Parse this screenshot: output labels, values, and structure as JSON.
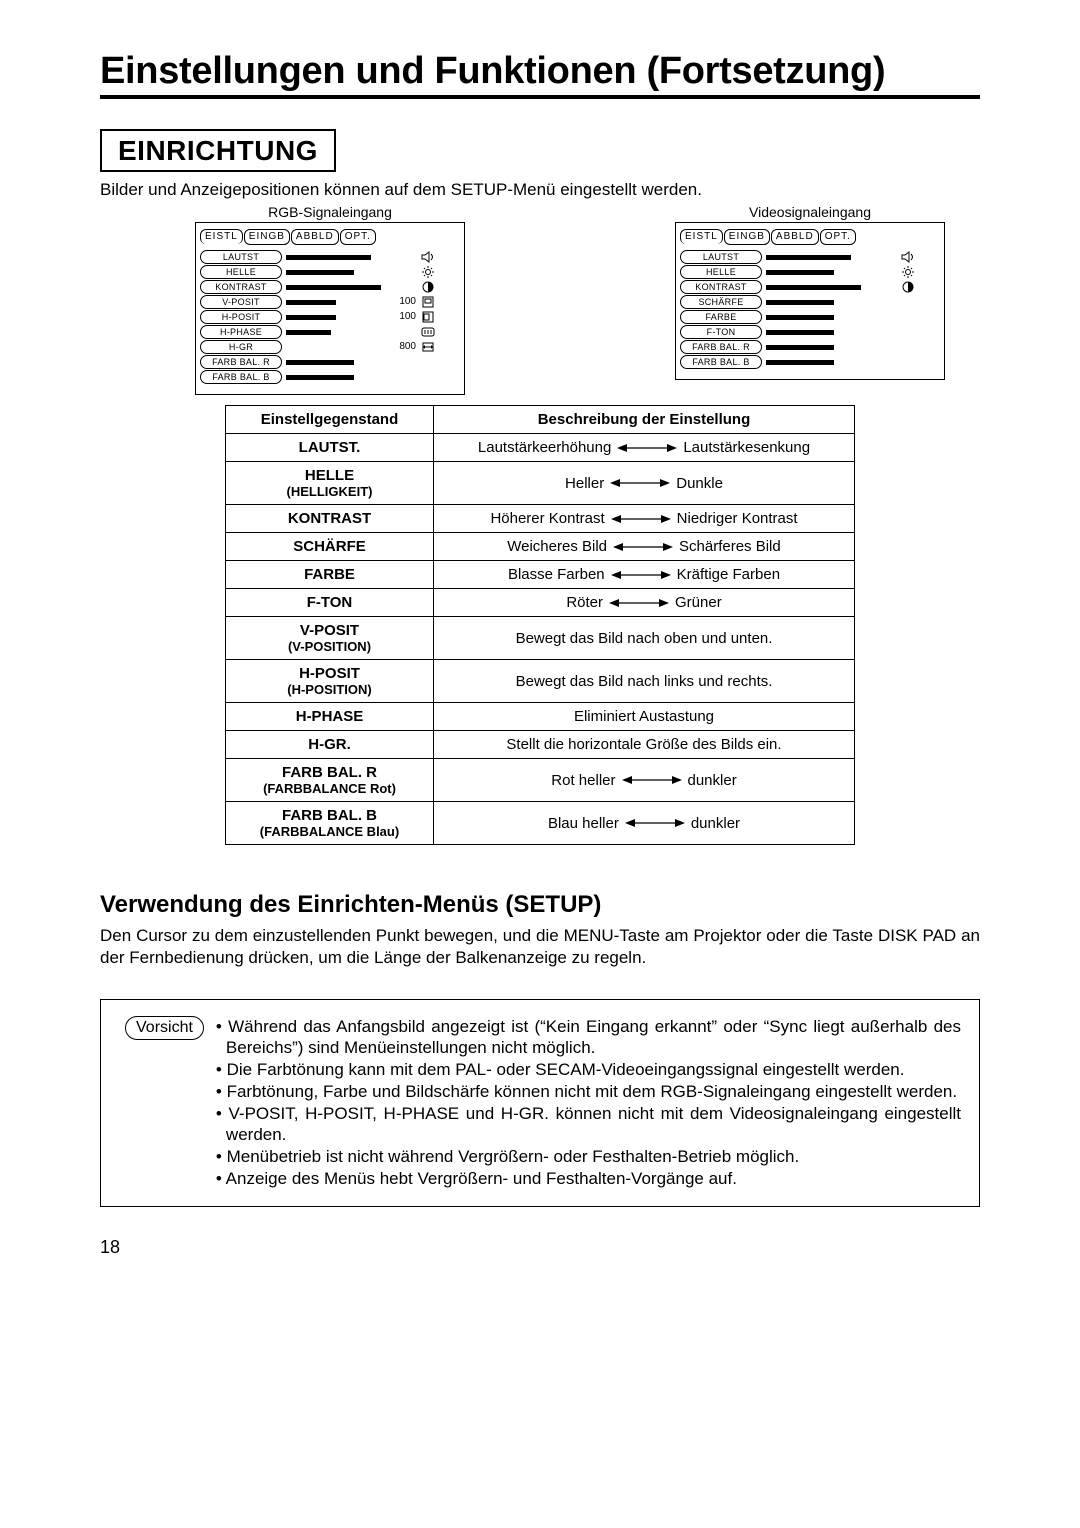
{
  "title": "Einstellungen und Funktionen (Fortsetzung)",
  "section": "EINRICHTUNG",
  "intro": "Bilder und Anzeigepositionen können auf dem SETUP-Menü eingestellt werden.",
  "page_number": "18",
  "menus": {
    "rgb": {
      "caption": "RGB-Signaleingang",
      "tabs": [
        "EISTL",
        "EINGB",
        "ABBLD",
        "OPT."
      ],
      "rows": [
        {
          "label": "LAUTST",
          "bar": 85,
          "value": "",
          "icon": "speaker"
        },
        {
          "label": "HELLE",
          "bar": 68,
          "value": "",
          "icon": "sun"
        },
        {
          "label": "KONTRAST",
          "bar": 95,
          "value": "",
          "icon": "halfmoon"
        },
        {
          "label": "V-POSIT",
          "bar": 50,
          "value": "100",
          "icon": "vpos"
        },
        {
          "label": "H-POSIT",
          "bar": 50,
          "value": "100",
          "icon": "hpos"
        },
        {
          "label": "H-PHASE",
          "bar": 45,
          "value": "",
          "icon": "phase"
        },
        {
          "label": "H-GR",
          "bar": 0,
          "value": "800",
          "icon": "hsize"
        },
        {
          "label": "FARB BAL. R",
          "bar": 68,
          "value": "",
          "icon": ""
        },
        {
          "label": "FARB BAL. B",
          "bar": 68,
          "value": "",
          "icon": ""
        }
      ]
    },
    "video": {
      "caption": "Videosignaleingang",
      "tabs": [
        "EISTL",
        "EINGB",
        "ABBLD",
        "OPT."
      ],
      "rows": [
        {
          "label": "LAUTST",
          "bar": 85,
          "value": "",
          "icon": "speaker"
        },
        {
          "label": "HELLE",
          "bar": 68,
          "value": "",
          "icon": "sun"
        },
        {
          "label": "KONTRAST",
          "bar": 95,
          "value": "",
          "icon": "halfmoon"
        },
        {
          "label": "SCHÄRFE",
          "bar": 68,
          "value": "",
          "icon": ""
        },
        {
          "label": "FARBE",
          "bar": 68,
          "value": "",
          "icon": ""
        },
        {
          "label": "F-TON",
          "bar": 68,
          "value": "",
          "icon": ""
        },
        {
          "label": "FARB BAL. R",
          "bar": 68,
          "value": "",
          "icon": ""
        },
        {
          "label": "FARB BAL. B",
          "bar": 68,
          "value": "",
          "icon": ""
        }
      ]
    }
  },
  "table": {
    "header": {
      "item": "Einstellgegenstand",
      "desc": "Beschreibung der Einstellung"
    },
    "rows": [
      {
        "item": "LAUTST.",
        "sub": "",
        "type": "arrow",
        "left": "Lautstärkeerhöhung",
        "right": "Lautstärkesenkung"
      },
      {
        "item": "HELLE",
        "sub": "(HELLIGKEIT)",
        "type": "arrow",
        "left": "Heller",
        "right": "Dunkle"
      },
      {
        "item": "KONTRAST",
        "sub": "",
        "type": "arrow",
        "left": "Höherer Kontrast",
        "right": "Niedriger Kontrast"
      },
      {
        "item": "SCHÄRFE",
        "sub": "",
        "type": "arrow",
        "left": "Weicheres Bild",
        "right": "Schärferes Bild"
      },
      {
        "item": "FARBE",
        "sub": "",
        "type": "arrow",
        "left": "Blasse Farben",
        "right": "Kräftige Farben"
      },
      {
        "item": "F-TON",
        "sub": "",
        "type": "arrow",
        "left": "Röter",
        "right": "Grüner"
      },
      {
        "item": "V-POSIT",
        "sub": "(V-POSITION)",
        "type": "text",
        "text": "Bewegt das Bild nach oben und unten."
      },
      {
        "item": "H-POSIT",
        "sub": "(H-POSITION)",
        "type": "text",
        "text": "Bewegt das Bild nach links und rechts."
      },
      {
        "item": "H-PHASE",
        "sub": "",
        "type": "text",
        "text": "Eliminiert Austastung"
      },
      {
        "item": "H-GR.",
        "sub": "",
        "type": "text",
        "text": "Stellt die horizontale Größe des Bilds ein."
      },
      {
        "item": "FARB BAL. R",
        "sub": "(FARBBALANCE Rot)",
        "type": "arrow",
        "left": "Rot heller",
        "right": "dunkler"
      },
      {
        "item": "FARB BAL. B",
        "sub": "(FARBBALANCE Blau)",
        "type": "arrow",
        "left": "Blau heller",
        "right": "dunkler"
      }
    ]
  },
  "sub_heading": "Verwendung des Einrichten-Menüs (SETUP)",
  "body_text": "Den Cursor zu dem einzustellenden Punkt bewegen, und die MENU-Taste am Projektor oder die Taste DISK PAD an der Fernbedienung drücken, um die Länge der Balkenanzeige zu regeln.",
  "caution": {
    "label": "Vorsicht",
    "items": [
      "Während das Anfangsbild angezeigt ist (“Kein Eingang erkannt” oder “Sync liegt außerhalb des Bereichs”) sind Menüeinstellungen nicht möglich.",
      "Die Farbtönung kann mit dem PAL- oder SECAM-Videoeingangssignal eingestellt werden.",
      "Farbtönung, Farbe und Bildschärfe können nicht mit dem RGB-Signaleingang eingestellt werden.",
      "V-POSIT, H-POSIT, H-PHASE und H-GR. können nicht mit dem Videosignaleingang eingestellt werden.",
      "Menübetrieb ist nicht während Vergrößern- oder Festhalten-Betrieb möglich.",
      "Anzeige des Menüs hebt Vergrößern- und Festhalten-Vorgänge auf."
    ]
  }
}
